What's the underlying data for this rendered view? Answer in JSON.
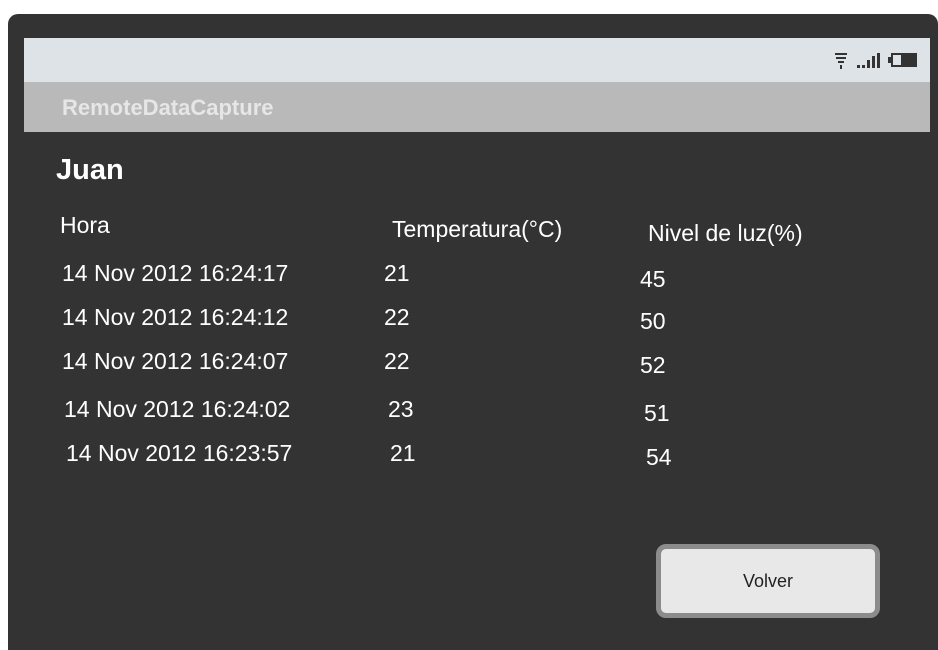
{
  "app": {
    "title": "RemoteDataCapture"
  },
  "status": {
    "icons": [
      "wifi-icon",
      "signal-icon",
      "battery-icon"
    ]
  },
  "user": {
    "name": "Juan"
  },
  "table": {
    "headers": [
      "Hora",
      "Temperatura(°C)",
      "Nivel de luz(%)"
    ],
    "rows": [
      [
        "14 Nov 2012 16:24:17",
        "21",
        "45"
      ],
      [
        "14 Nov 2012 16:24:12",
        "22",
        "50"
      ],
      [
        "14 Nov 2012 16:24:07",
        "22",
        "52"
      ],
      [
        "14 Nov 2012 16:24:02",
        "23",
        "51"
      ],
      [
        "14 Nov 2012 16:23:57",
        "21",
        "54"
      ]
    ]
  },
  "actions": {
    "back_label": "Volver"
  },
  "colors": {
    "background": "#333333",
    "status_bar": "#dde3e6",
    "title_bar": "#b9b9b9",
    "button": "#e8e8e8"
  }
}
